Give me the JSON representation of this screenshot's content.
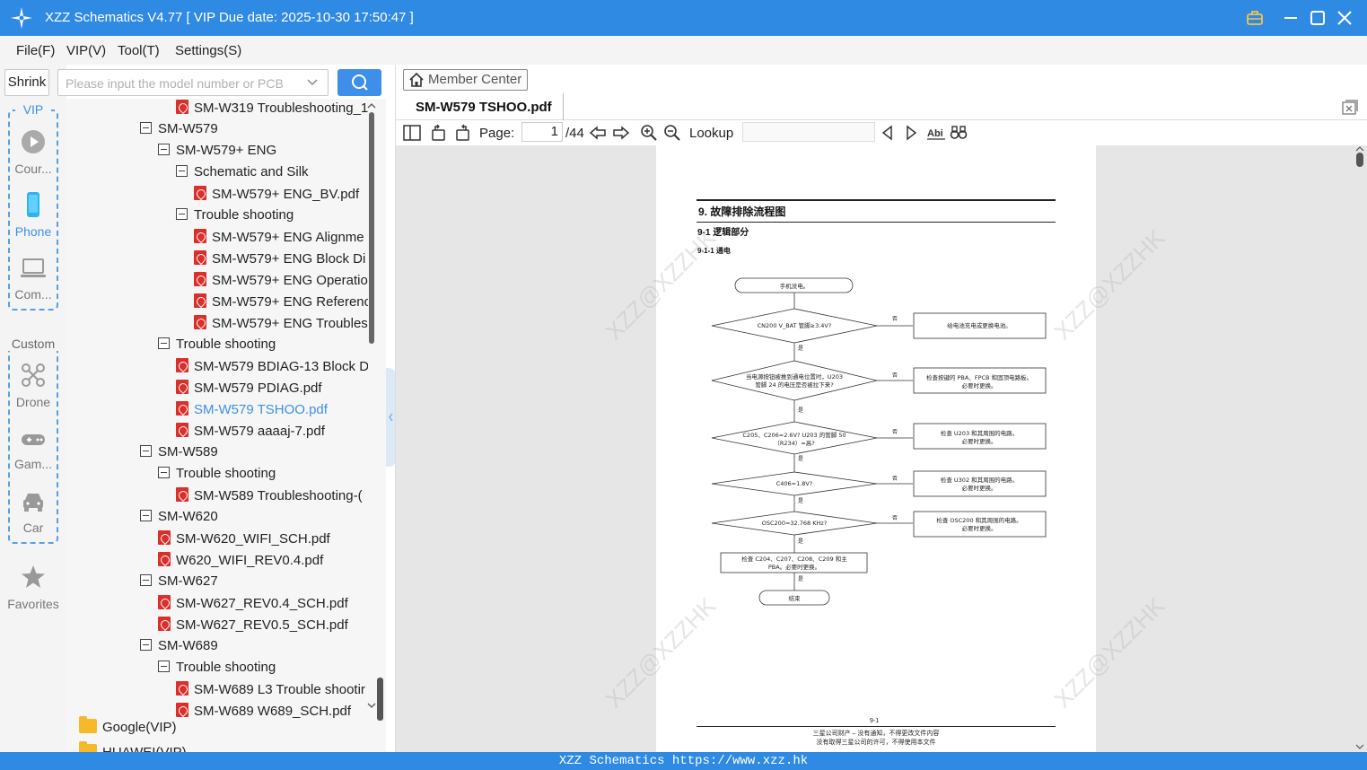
{
  "titlebar": {
    "title": "XZZ Schematics V4.77 [ VIP Due date: 2025-10-30 17:50:47 ]"
  },
  "menu": {
    "items": [
      "File(F)",
      "VIP(V)",
      "Tool(T)",
      "Settings(S)"
    ]
  },
  "search": {
    "shrink_label": "Shrink",
    "placeholder": "Please input the model number or PCB"
  },
  "rail": {
    "vip_label": "VIP",
    "vip_items": [
      {
        "label": "Cour...",
        "icon": "play-icon"
      },
      {
        "label": "Phone",
        "icon": "phone-icon",
        "active": true
      },
      {
        "label": "Com...",
        "icon": "laptop-icon"
      }
    ],
    "custom_label": "Custom",
    "custom_items": [
      {
        "label": "Drone",
        "icon": "drone-icon"
      },
      {
        "label": "Gam...",
        "icon": "gamepad-icon"
      },
      {
        "label": "Car",
        "icon": "car-icon"
      }
    ],
    "favorites_label": "Favorites"
  },
  "tree": {
    "rows": [
      {
        "label": "SM-W319 Troubleshooting_1",
        "type": "pdf"
      },
      {
        "label": "SM-W579",
        "type": "folder"
      },
      {
        "label": "SM-W579+ ENG",
        "type": "folder"
      },
      {
        "label": "Schematic and Silk",
        "type": "folder"
      },
      {
        "label": "SM-W579+ ENG_BV.pdf",
        "type": "pdf"
      },
      {
        "label": "Trouble shooting",
        "type": "folder"
      },
      {
        "label": "SM-W579+ ENG Alignme",
        "type": "pdf"
      },
      {
        "label": "SM-W579+ ENG Block Di",
        "type": "pdf"
      },
      {
        "label": "SM-W579+ ENG Operatio",
        "type": "pdf"
      },
      {
        "label": "SM-W579+ ENG Referenc",
        "type": "pdf"
      },
      {
        "label": "SM-W579+ ENG Troubles",
        "type": "pdf"
      },
      {
        "label": "Trouble shooting",
        "type": "folder"
      },
      {
        "label": "SM-W579 BDIAG-13 Block D",
        "type": "pdf"
      },
      {
        "label": "SM-W579 PDIAG.pdf",
        "type": "pdf"
      },
      {
        "label": "SM-W579 TSHOO.pdf",
        "type": "pdf",
        "selected": true
      },
      {
        "label": "SM-W579 aaaaj-7.pdf",
        "type": "pdf"
      },
      {
        "label": "SM-W589",
        "type": "folder"
      },
      {
        "label": "Trouble shooting",
        "type": "folder"
      },
      {
        "label": "SM-W589 Troubleshooting-(",
        "type": "pdf"
      },
      {
        "label": "SM-W620",
        "type": "folder"
      },
      {
        "label": "SM-W620_WIFI_SCH.pdf",
        "type": "pdf"
      },
      {
        "label": "W620_WIFI_REV0.4.pdf",
        "type": "pdf"
      },
      {
        "label": "SM-W627",
        "type": "folder"
      },
      {
        "label": "SM-W627_REV0.4_SCH.pdf",
        "type": "pdf"
      },
      {
        "label": "SM-W627_REV0.5_SCH.pdf",
        "type": "pdf"
      },
      {
        "label": "SM-W689",
        "type": "folder"
      },
      {
        "label": "Trouble shooting",
        "type": "folder"
      },
      {
        "label": "SM-W689 L3 Trouble shootir",
        "type": "pdf"
      },
      {
        "label": "SM-W689 W689_SCH.pdf",
        "type": "pdf"
      }
    ],
    "brand_folders": [
      "Google(VIP)",
      "HUAWEI(VIP)"
    ]
  },
  "viewer": {
    "member_center": "Member Center",
    "tab_title": "SM-W579 TSHOO.pdf",
    "page_label": "Page:",
    "page_value": "1",
    "page_total": "/44",
    "lookup_label": "Lookup"
  },
  "document": {
    "section_title": "9. 故障排除流程图",
    "sub1": "9-1 逻辑部分",
    "sub2": "9-1-1 通电",
    "flow": {
      "start": "手机没电。",
      "d1": "CN200 V_BAT 管脚≥3.4V?",
      "a1": "给电池充电或更换电池。",
      "d2a": "当电源按钮被推到通电位置时，U203",
      "d2b": "管脚 24 的电压是否被拉下来?",
      "a2a": "检查按键的 PBA、FPCB 和固顶电路板。",
      "a2b": "必要时更换。",
      "d3a": "C205、C206=2.6V?  U203 的管脚 50",
      "d3b": "（R234）=高?",
      "a3a": "检查 U203 和其周围的电路。",
      "a3b": "必要时更换。",
      "d4": "C406=1.8V?",
      "a4a": "检查 U302 和其周围的电路。",
      "a4b": "必要时更换。",
      "d5": "OSC200=32.768 KHz?",
      "a5a": "检查 OSC200 和其周围的电路。",
      "a5b": "必要时更换。",
      "b6a": "检查 C204、C207、C208、C209 和主",
      "b6b": "PBA。必要时更换。",
      "end": "结束",
      "yes": "是",
      "no": "否"
    },
    "watermark": "XZZ@XZZHK",
    "page_number": "9-1",
    "footer1": "三星公司财产 – 没有通知，不得更改文件内容",
    "footer2": "没有取得三星公司的许可，不得使用本文件"
  },
  "statusbar": {
    "text": "XZZ Schematics https://www.xzz.hk"
  },
  "colors": {
    "accent": "#2f8ae4",
    "selected_text": "#3d8fe9",
    "pdf_red": "#d9302c",
    "folder_yellow": "#f5b92a"
  }
}
